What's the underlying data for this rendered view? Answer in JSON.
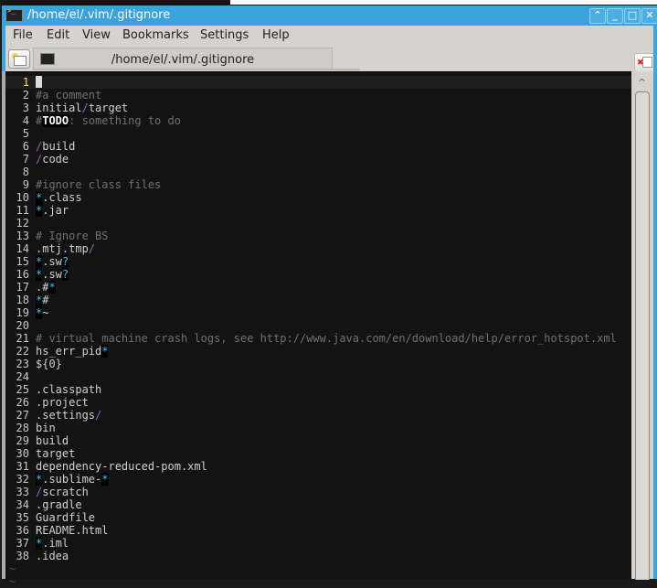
{
  "window": {
    "title": "/home/el/.vim/.gitignore",
    "controls": [
      "keep-above",
      "minimize",
      "maximize",
      "close"
    ]
  },
  "menu": [
    "File",
    "Edit",
    "View",
    "Bookmarks",
    "Settings",
    "Help"
  ],
  "tab": {
    "label": "/home/el/.vim/.gitignore"
  },
  "editor": {
    "cursor_line": 1,
    "lines": [
      "",
      "#a comment",
      "initial/target",
      "#TODO: something to do",
      "",
      "/build",
      "/code",
      "",
      "#ignore class files",
      "*.class",
      "*.jar",
      "",
      "# Ignore BS",
      ".mtj.tmp/",
      "*.sw?",
      "*.sw?",
      ".#*",
      "*#",
      "*~",
      "",
      "# virtual machine crash logs, see http://www.java.com/en/download/help/error_hotspot.xml",
      "hs_err_pid*",
      "${0}",
      "",
      ".classpath",
      ".project",
      ".settings/",
      "bin",
      "build",
      "target",
      "dependency-reduced-pom.xml",
      "*.sublime-*",
      "/scratch",
      ".gradle",
      "Guardfile",
      "README.html",
      "*.iml",
      ".idea"
    ],
    "empty_marker": "~",
    "empty_marker_count": 2
  },
  "colors": {
    "titlebar": "#3ba3db",
    "terminal_bg": "#131313",
    "comment": "#707070",
    "slash": "#9b5fc9",
    "glob": "#3ec3ef",
    "current_line_number": "#f0e060"
  }
}
